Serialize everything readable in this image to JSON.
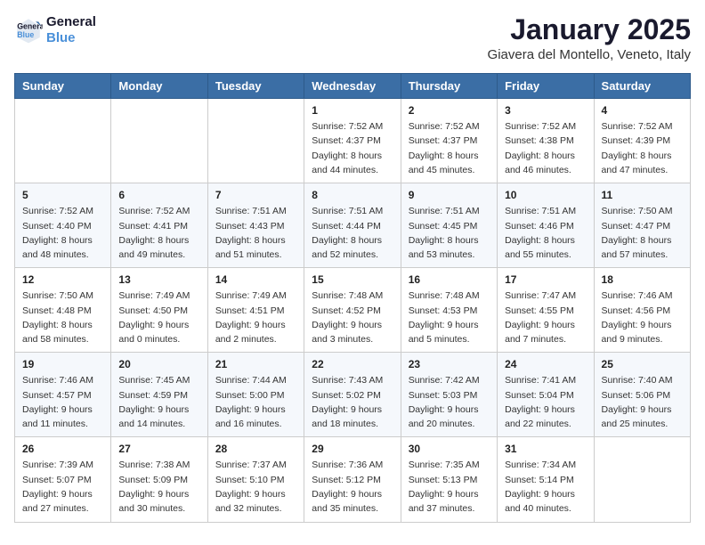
{
  "header": {
    "logo_line1": "General",
    "logo_line2": "Blue",
    "month": "January 2025",
    "location": "Giavera del Montello, Veneto, Italy"
  },
  "weekdays": [
    "Sunday",
    "Monday",
    "Tuesday",
    "Wednesday",
    "Thursday",
    "Friday",
    "Saturday"
  ],
  "weeks": [
    [
      null,
      null,
      null,
      {
        "day": 1,
        "sunrise": "7:52 AM",
        "sunset": "4:37 PM",
        "daylight": "8 hours and 44 minutes."
      },
      {
        "day": 2,
        "sunrise": "7:52 AM",
        "sunset": "4:37 PM",
        "daylight": "8 hours and 45 minutes."
      },
      {
        "day": 3,
        "sunrise": "7:52 AM",
        "sunset": "4:38 PM",
        "daylight": "8 hours and 46 minutes."
      },
      {
        "day": 4,
        "sunrise": "7:52 AM",
        "sunset": "4:39 PM",
        "daylight": "8 hours and 47 minutes."
      }
    ],
    [
      {
        "day": 5,
        "sunrise": "7:52 AM",
        "sunset": "4:40 PM",
        "daylight": "8 hours and 48 minutes."
      },
      {
        "day": 6,
        "sunrise": "7:52 AM",
        "sunset": "4:41 PM",
        "daylight": "8 hours and 49 minutes."
      },
      {
        "day": 7,
        "sunrise": "7:51 AM",
        "sunset": "4:43 PM",
        "daylight": "8 hours and 51 minutes."
      },
      {
        "day": 8,
        "sunrise": "7:51 AM",
        "sunset": "4:44 PM",
        "daylight": "8 hours and 52 minutes."
      },
      {
        "day": 9,
        "sunrise": "7:51 AM",
        "sunset": "4:45 PM",
        "daylight": "8 hours and 53 minutes."
      },
      {
        "day": 10,
        "sunrise": "7:51 AM",
        "sunset": "4:46 PM",
        "daylight": "8 hours and 55 minutes."
      },
      {
        "day": 11,
        "sunrise": "7:50 AM",
        "sunset": "4:47 PM",
        "daylight": "8 hours and 57 minutes."
      }
    ],
    [
      {
        "day": 12,
        "sunrise": "7:50 AM",
        "sunset": "4:48 PM",
        "daylight": "8 hours and 58 minutes."
      },
      {
        "day": 13,
        "sunrise": "7:49 AM",
        "sunset": "4:50 PM",
        "daylight": "9 hours and 0 minutes."
      },
      {
        "day": 14,
        "sunrise": "7:49 AM",
        "sunset": "4:51 PM",
        "daylight": "9 hours and 2 minutes."
      },
      {
        "day": 15,
        "sunrise": "7:48 AM",
        "sunset": "4:52 PM",
        "daylight": "9 hours and 3 minutes."
      },
      {
        "day": 16,
        "sunrise": "7:48 AM",
        "sunset": "4:53 PM",
        "daylight": "9 hours and 5 minutes."
      },
      {
        "day": 17,
        "sunrise": "7:47 AM",
        "sunset": "4:55 PM",
        "daylight": "9 hours and 7 minutes."
      },
      {
        "day": 18,
        "sunrise": "7:46 AM",
        "sunset": "4:56 PM",
        "daylight": "9 hours and 9 minutes."
      }
    ],
    [
      {
        "day": 19,
        "sunrise": "7:46 AM",
        "sunset": "4:57 PM",
        "daylight": "9 hours and 11 minutes."
      },
      {
        "day": 20,
        "sunrise": "7:45 AM",
        "sunset": "4:59 PM",
        "daylight": "9 hours and 14 minutes."
      },
      {
        "day": 21,
        "sunrise": "7:44 AM",
        "sunset": "5:00 PM",
        "daylight": "9 hours and 16 minutes."
      },
      {
        "day": 22,
        "sunrise": "7:43 AM",
        "sunset": "5:02 PM",
        "daylight": "9 hours and 18 minutes."
      },
      {
        "day": 23,
        "sunrise": "7:42 AM",
        "sunset": "5:03 PM",
        "daylight": "9 hours and 20 minutes."
      },
      {
        "day": 24,
        "sunrise": "7:41 AM",
        "sunset": "5:04 PM",
        "daylight": "9 hours and 22 minutes."
      },
      {
        "day": 25,
        "sunrise": "7:40 AM",
        "sunset": "5:06 PM",
        "daylight": "9 hours and 25 minutes."
      }
    ],
    [
      {
        "day": 26,
        "sunrise": "7:39 AM",
        "sunset": "5:07 PM",
        "daylight": "9 hours and 27 minutes."
      },
      {
        "day": 27,
        "sunrise": "7:38 AM",
        "sunset": "5:09 PM",
        "daylight": "9 hours and 30 minutes."
      },
      {
        "day": 28,
        "sunrise": "7:37 AM",
        "sunset": "5:10 PM",
        "daylight": "9 hours and 32 minutes."
      },
      {
        "day": 29,
        "sunrise": "7:36 AM",
        "sunset": "5:12 PM",
        "daylight": "9 hours and 35 minutes."
      },
      {
        "day": 30,
        "sunrise": "7:35 AM",
        "sunset": "5:13 PM",
        "daylight": "9 hours and 37 minutes."
      },
      {
        "day": 31,
        "sunrise": "7:34 AM",
        "sunset": "5:14 PM",
        "daylight": "9 hours and 40 minutes."
      },
      null
    ]
  ]
}
